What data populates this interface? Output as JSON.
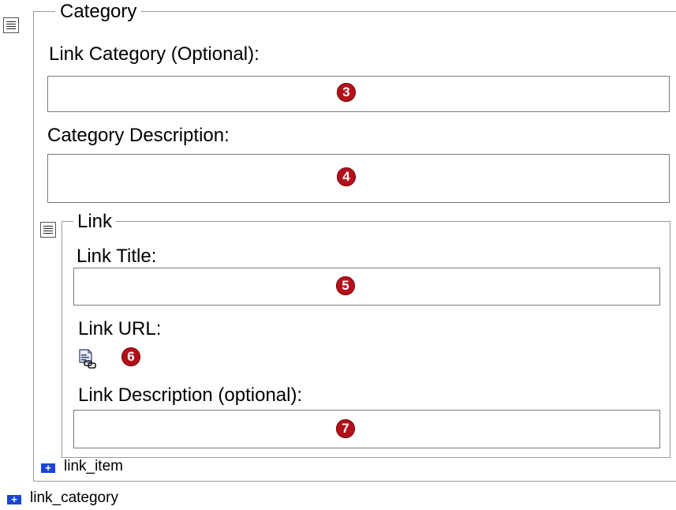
{
  "category": {
    "legend": "Category",
    "link_category_label": "Link Category (Optional):",
    "link_category_badge": "3",
    "category_description_label": "Category Description:",
    "category_description_badge": "4"
  },
  "link": {
    "legend": "Link",
    "title_label": "Link Title:",
    "title_badge": "5",
    "url_label": "Link URL:",
    "url_badge": "6",
    "description_label": "Link Description (optional):",
    "description_badge": "7"
  },
  "repeat": {
    "link_item": "link_item",
    "link_category": "link_category"
  },
  "icons": {
    "menu": "menu-icon",
    "url_picker": "document-link-icon",
    "add": "plus-icon"
  },
  "colors": {
    "badge": "#b3111a",
    "add_icon": "#1a45d6"
  }
}
